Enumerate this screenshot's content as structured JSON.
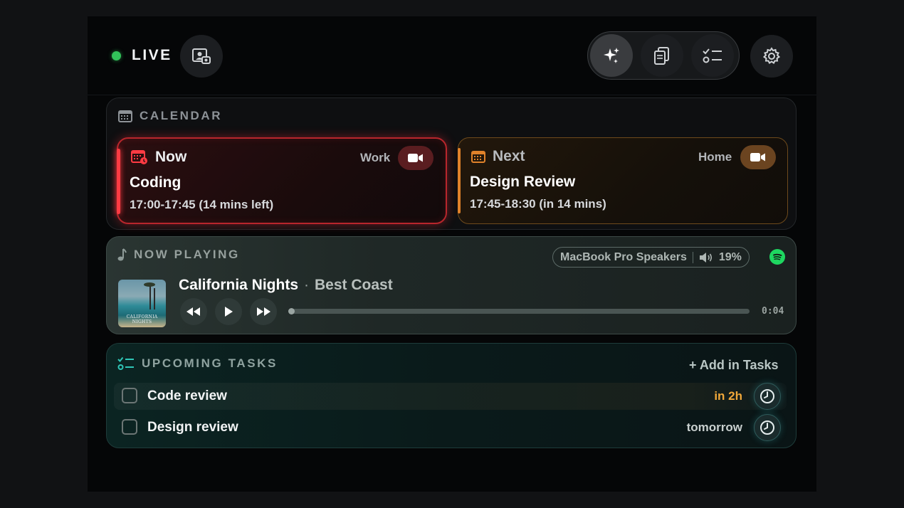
{
  "header": {
    "live_label": "LIVE",
    "icons": [
      "screen-capture-icon",
      "sparkle-icon",
      "clipboard-icon",
      "checklist-icon",
      "gear-icon"
    ],
    "active_segment": "sparkle"
  },
  "calendar": {
    "title": "CALENDAR",
    "now": {
      "label": "Now",
      "tag": "Work",
      "title": "Coding",
      "time": "17:00-17:45 (14 mins left)",
      "accent": "#ff3b43"
    },
    "next": {
      "label": "Next",
      "tag": "Home",
      "title": "Design Review",
      "time": "17:45-18:30 (in 14 mins)",
      "accent": "#e0822a"
    }
  },
  "now_playing": {
    "title": "NOW PLAYING",
    "output_device": "MacBook Pro Speakers",
    "volume": "19%",
    "song": "California Nights",
    "separator": "·",
    "artist": "Best Coast",
    "album_text": "CALIFORNIA NIGHTS",
    "elapsed": "0:04",
    "progress_fraction": 0.0
  },
  "tasks": {
    "title": "UPCOMING TASKS",
    "add_label": "+ Add in Tasks",
    "items": [
      {
        "label": "Code review",
        "due": "in 2h",
        "due_color": "#f0a83a"
      },
      {
        "label": "Design review",
        "due": "tomorrow",
        "due_color": "#c9d0cf"
      }
    ]
  }
}
